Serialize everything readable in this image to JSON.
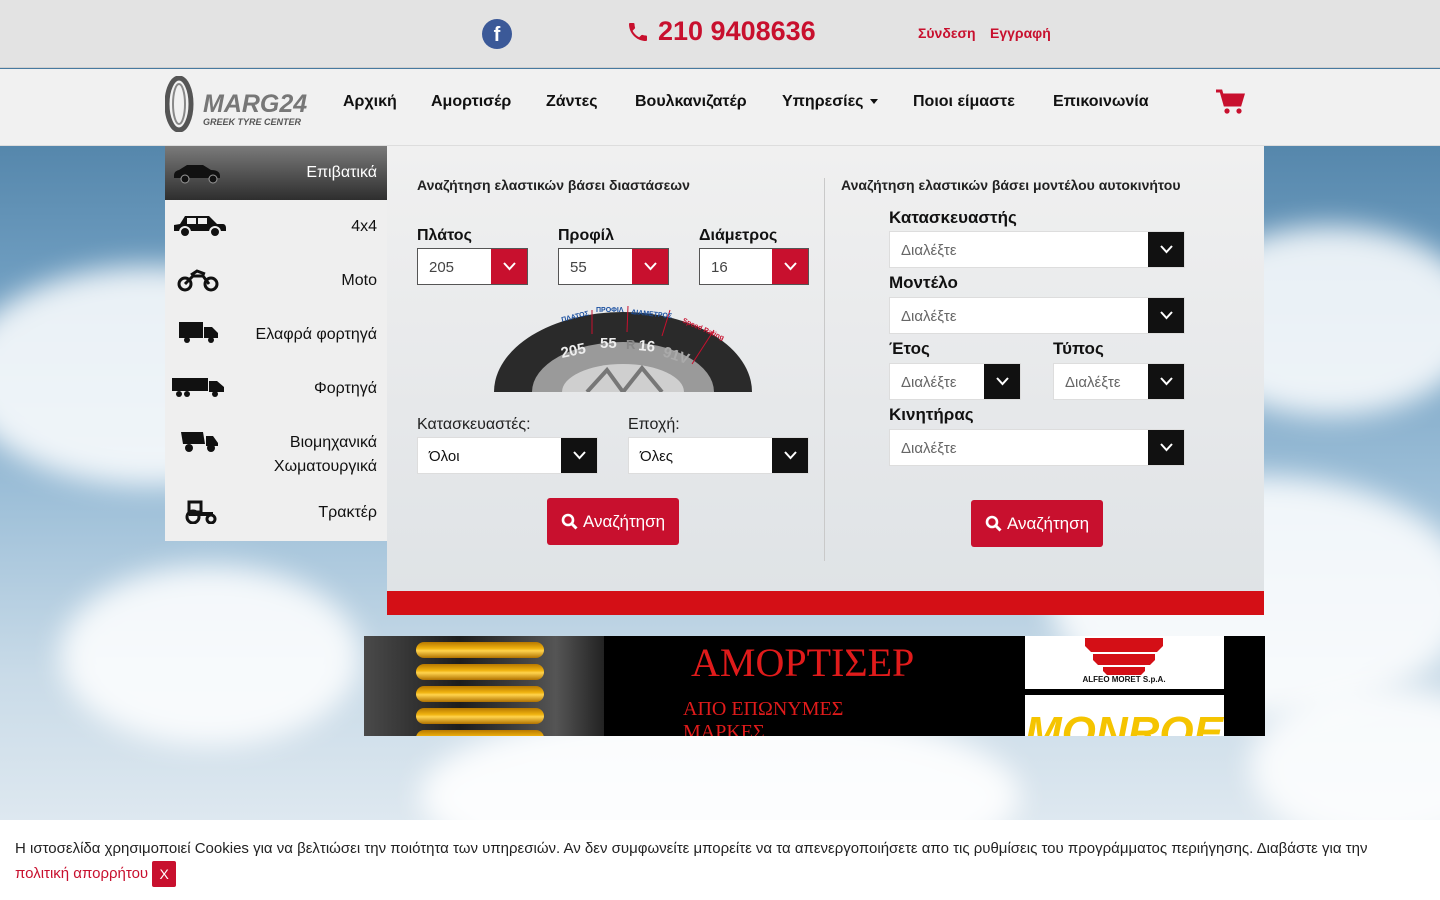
{
  "topbar": {
    "phone": "210 9408636",
    "login": "Σύνδεση",
    "register": "Εγγραφή"
  },
  "logo": {
    "text": "MARG24",
    "tagline": "GREEK TYRE CENTER"
  },
  "nav": {
    "items": [
      "Αρχική",
      "Αμορτισέρ",
      "Ζάντες",
      "Βουλκανιζατέρ",
      "Υπηρεσίες",
      "Ποιοι είμαστε",
      "Επικοινωνία"
    ]
  },
  "categories": [
    {
      "label": "Επιβατικά",
      "icon": "car-icon",
      "active": true
    },
    {
      "label": "4x4",
      "icon": "suv-icon"
    },
    {
      "label": "Moto",
      "icon": "motorcycle-icon"
    },
    {
      "label": "Ελαφρά φορτηγά",
      "icon": "light-truck-icon"
    },
    {
      "label": "Φορτηγά",
      "icon": "truck-icon"
    },
    {
      "label": "Βιομηχανικά Χωματουργικά",
      "icon": "dump-truck-icon"
    },
    {
      "label": "Τρακτέρ",
      "icon": "tractor-icon"
    }
  ],
  "dimension_search": {
    "title": "Αναζήτηση ελαστικών βάσει διαστάσεων",
    "width_label": "Πλάτος",
    "width_value": "205",
    "profile_label": "Προφίλ",
    "profile_value": "55",
    "diameter_label": "Διάμετρος",
    "diameter_value": "16",
    "tyre_labels": {
      "width": "ΠΛΑΤΟΣ",
      "profile": "ΠΡΟΦΙΛ",
      "diameter": "ΔΙΑΜΕΤΡΟΣ",
      "speed": "Speed Rating",
      "w": "205",
      "p": "55",
      "r": "R",
      "d": "16",
      "s": "91V"
    },
    "maker_label": "Κατασκευαστές:",
    "maker_value": "Όλοι",
    "season_label": "Εποχή:",
    "season_value": "Όλες",
    "button": "Αναζήτηση"
  },
  "model_search": {
    "title": "Αναζήτηση ελαστικών βάσει μοντέλου αυτοκινήτου",
    "manufacturer_label": "Κατασκευαστής",
    "model_label": "Μοντέλο",
    "year_label": "Έτος",
    "type_label": "Τύπος",
    "engine_label": "Κινητήρας",
    "placeholder": "Διαλέξτε",
    "button": "Αναζήτηση"
  },
  "banner": {
    "title": "ΑΜΟΡΤΙΣΕΡ",
    "subtitle": "ΑΠΟ ΕΠΩΝΥΜΕΣ ΜΑΡΚΕΣ",
    "brand1": "ALFEO MORET S.p.A.",
    "brand2": "MONROE"
  },
  "cookies": {
    "text": "Η ιστοσελίδα χρησιμοποιεί Cookies για να βελτιώσει την ποιότητα των υπηρεσιών. Αν δεν συμφωνείτε μπορείτε να τα απενεργοποιήσετε απο τις ρυθμίσεις του προγράμματος περιήγησης. Διαβάστε για την",
    "link": "πολιτική απορρήτου",
    "close": "X"
  },
  "colors": {
    "brand_red": "#c8102e",
    "dark": "#111111"
  }
}
